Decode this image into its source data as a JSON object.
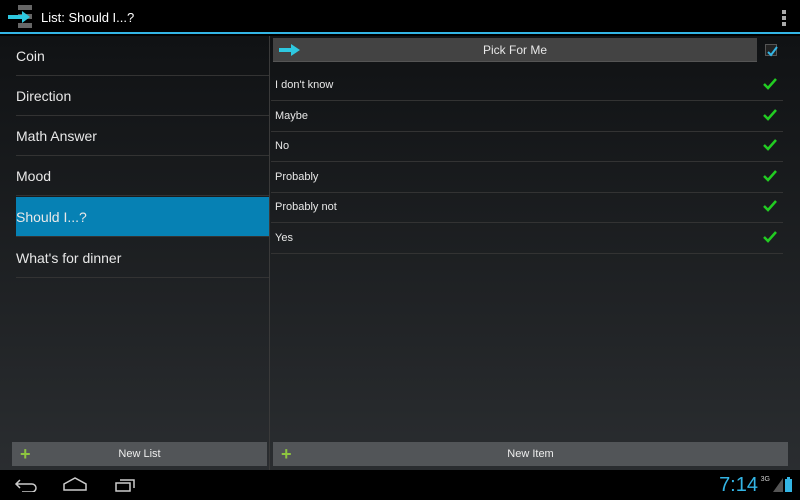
{
  "header": {
    "title": "List: Should I...?"
  },
  "lists": [
    {
      "label": "Coin"
    },
    {
      "label": "Direction"
    },
    {
      "label": "Math Answer"
    },
    {
      "label": "Mood"
    },
    {
      "label": "Should I...?",
      "selected": true
    },
    {
      "label": "What's for dinner"
    }
  ],
  "pick_button": "Pick For Me",
  "pick_checkbox_checked": true,
  "items": [
    {
      "label": "I don't know"
    },
    {
      "label": "Maybe"
    },
    {
      "label": "No"
    },
    {
      "label": "Probably"
    },
    {
      "label": "Probably not"
    },
    {
      "label": "Yes"
    }
  ],
  "new_list_label": "New List",
  "new_item_label": "New Item",
  "status": {
    "time": "7:14",
    "network": "3G"
  },
  "colors": {
    "accent": "#33b5e5",
    "selected": "#0681b4",
    "check": "#22cc22"
  }
}
